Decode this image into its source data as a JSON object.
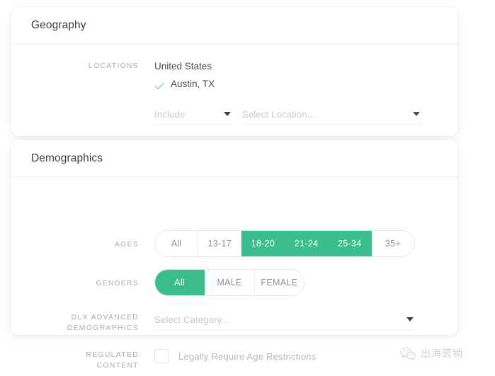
{
  "colors": {
    "accent_green": "#3cbd8d",
    "card_background": "#ffffff",
    "page_background": "#ffffff",
    "label_gray": "#a9adb3",
    "value_gray": "#4a4f56",
    "placeholder_gray": "#c8cbcf"
  },
  "geography": {
    "title": "Geography",
    "locations": {
      "label": "LOCATIONS",
      "country": "United States",
      "selected_city": "Austin, TX",
      "check_icon": "check-icon"
    },
    "include_dropdown": {
      "value": "Include",
      "icon": "chevron-down-icon"
    },
    "location_dropdown": {
      "placeholder": "Select Location...",
      "icon": "chevron-down-icon"
    }
  },
  "demographics": {
    "title": "Demographics",
    "ages": {
      "label": "AGES",
      "options": [
        {
          "label": "All",
          "selected": false
        },
        {
          "label": "13-17",
          "selected": false
        },
        {
          "label": "18-20",
          "selected": true
        },
        {
          "label": "21-24",
          "selected": true
        },
        {
          "label": "25-34",
          "selected": true
        },
        {
          "label": "35+",
          "selected": false
        }
      ]
    },
    "genders": {
      "label": "GENDERS",
      "options": [
        {
          "label": "All",
          "selected": true
        },
        {
          "label": "MALE",
          "selected": false
        },
        {
          "label": "FEMALE",
          "selected": false
        }
      ]
    },
    "dlx": {
      "label_line1": "DLX ADVANCED",
      "label_line2": "DEMOGRAPHICS",
      "placeholder": "Select Category...",
      "icon": "chevron-down-icon"
    },
    "regulated": {
      "label_line1": "REGULATED",
      "label_line2": "CONTENT",
      "checkbox_label": "Legally Require Age Restrictions",
      "checked": false
    }
  },
  "watermark": {
    "icon": "wechat-icon",
    "text": "出海营销"
  }
}
